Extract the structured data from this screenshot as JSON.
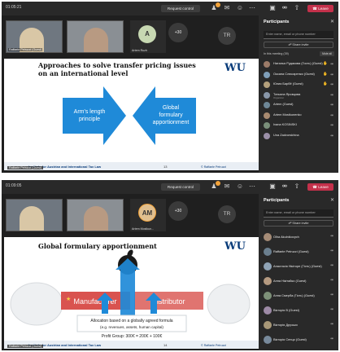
{
  "shot1": {
    "timer": "01:05:21",
    "request_control": "Request control",
    "leave": "Leave",
    "tiles": [
      {
        "label": "Raffaele Petruzzi (Guest)"
      },
      {
        "label": "Artem Ruzhnikov"
      }
    ],
    "avatar": {
      "initial": "A",
      "name": "Artem Ruzh"
    },
    "plus": "+30",
    "tr": "TR",
    "slide": {
      "title_line1": "Approaches to solve transfer pricing issues",
      "title_line2": "on an international level",
      "logo": "WU",
      "left_arrow_line1": "Arm's length",
      "left_arrow_line2": "principle",
      "right_arrow_line1": "Global",
      "right_arrow_line2": "formulary",
      "right_arrow_line3": "apportionment",
      "footer_institute": "Institute for Austrian and International Tax Law",
      "footer_page": "13",
      "footer_right": "© Raffaele Petruzzi",
      "presenter": "Raffaele Petruzzi (Guest)"
    },
    "panel": {
      "title": "Participants",
      "search_placeholder": "Enter name, email or phone number",
      "share_invite": "Share invite",
      "in_meeting": "In this meeting (39)",
      "mute_all": "Mute all",
      "people": [
        {
          "name": "Наталья Рудакова (Гость) (Guest)",
          "sub": ""
        },
        {
          "name": "Оксана Слюсаренко (Guest)",
          "sub": ""
        },
        {
          "name": "Юлия Барбё (Guest)",
          "sub": ""
        },
        {
          "name": "Татьяна Яровцова",
          "sub": "Organizer"
        },
        {
          "name": "Artem (Guest)",
          "sub": ""
        },
        {
          "name": "Artem Mostkunenko",
          "sub": ""
        },
        {
          "name": "Ivana KOSINSKI",
          "sub": ""
        },
        {
          "name": "Una Zadvorskhina",
          "sub": ""
        }
      ]
    }
  },
  "shot2": {
    "timer": "01:09:05",
    "request_control": "Request control",
    "leave": "Leave",
    "tiles": [
      {
        "label": ""
      },
      {
        "label": ""
      }
    ],
    "avatar": {
      "initial": "AM",
      "name": "Artem Mostkun..."
    },
    "plus": "+30",
    "tr": "TR",
    "slide": {
      "title": "Global formulary apportionment",
      "logo": "WU",
      "box_left": "Manufacturer",
      "box_right": "Distributor",
      "allocation_line1": "Allocation based on a globally agreed formula",
      "allocation_line2": "(e.g. revenues, assets, human capital)",
      "profit": "Profit Group: 300€ = 200€ + 100€",
      "footer_institute": "Institute for Austrian and International Tax Law",
      "footer_page": "14",
      "footer_right": "© Raffaele Petruzzi",
      "presenter": "Raffaele Petruzzi (Guest)"
    },
    "panel": {
      "title": "Participants",
      "search_placeholder": "Enter name, email or phone number",
      "share_invite": "Share invite",
      "people": [
        {
          "name": "Olha Akulnikovych"
        },
        {
          "name": "Raffaele Petruzzi (Guest)"
        },
        {
          "name": "Анастасія Нікіторе (Гість) (Guest)"
        },
        {
          "name": "Анна Нікітайко (Guest)"
        },
        {
          "name": "Анна Смерба (Гість) (Guest)"
        },
        {
          "name": "Вікторія В (Guest)"
        },
        {
          "name": "Вікторія Друзько"
        },
        {
          "name": "Вікторія Сенцо (Guest)"
        }
      ]
    }
  }
}
